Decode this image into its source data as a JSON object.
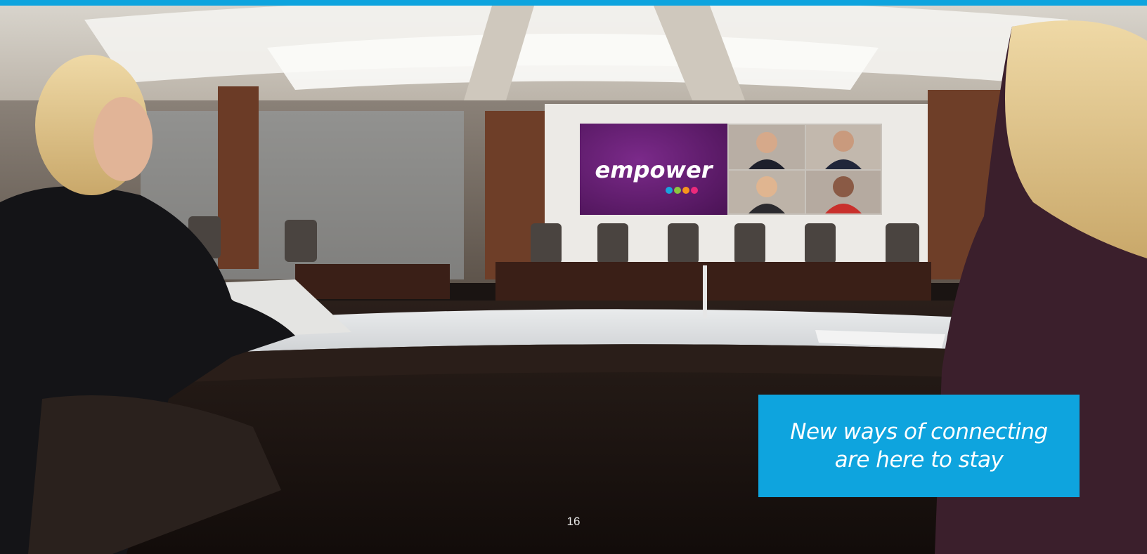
{
  "colors": {
    "accent": "#0ea4de",
    "callout_text": "#ffffff"
  },
  "photo": {
    "screen_logo": "empower"
  },
  "callout": {
    "line1": "New ways of connecting",
    "line2": "are here to stay"
  },
  "page_number": "16"
}
